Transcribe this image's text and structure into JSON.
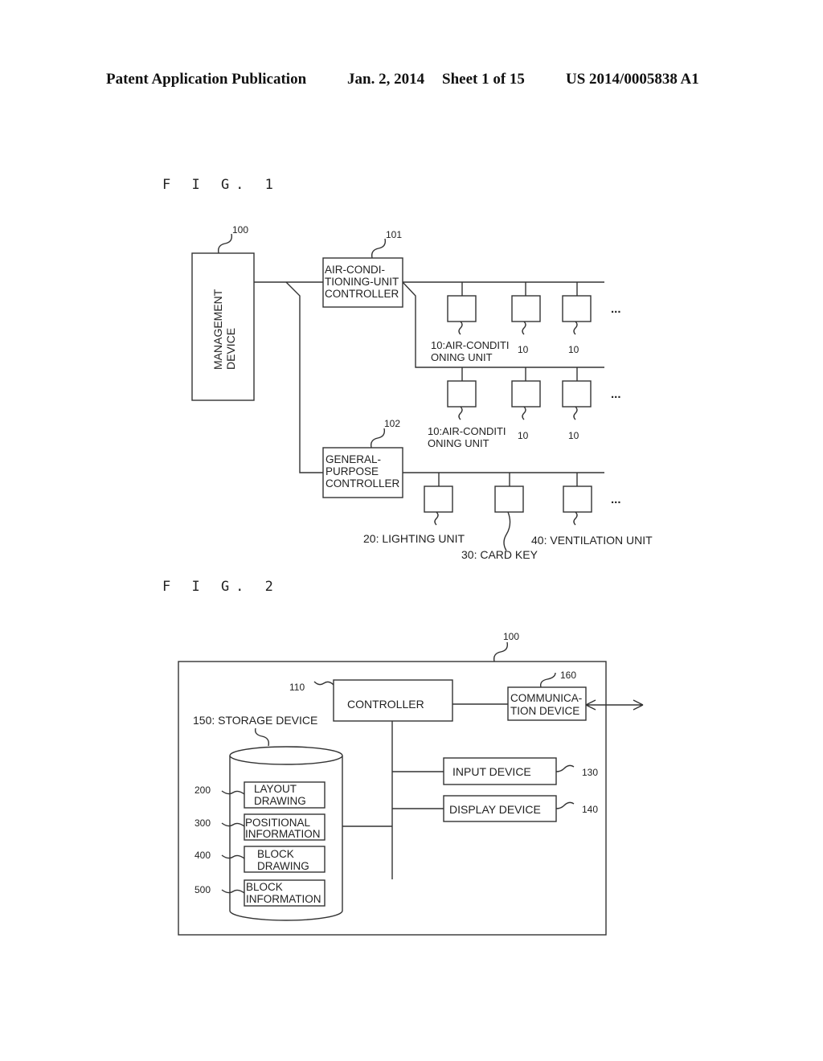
{
  "header": {
    "publication": "Patent Application Publication",
    "date": "Jan. 2, 2014",
    "sheet": "Sheet 1 of 15",
    "number": "US 2014/0005838 A1"
  },
  "fig1": {
    "label": "F I G. 1",
    "management_device": {
      "ref": "100",
      "line1": "MANAGEMENT",
      "line2": "DEVICE"
    },
    "ac_controller": {
      "ref": "101",
      "line1": "AIR-CONDI-",
      "line2": "TIONING-UNIT",
      "line3": "CONTROLLER"
    },
    "gp_controller": {
      "ref": "102",
      "line1": "GENERAL-",
      "line2": "PURPOSE",
      "line3": "CONTROLLER"
    },
    "ac_unit_label": {
      "line1": "10:AIR-CONDITI",
      "line2": "ONING UNIT"
    },
    "ac_unit_ref": "10",
    "ellipsis": "...",
    "lighting_unit": "20: LIGHTING UNIT",
    "card_key": "30: CARD KEY",
    "ventilation_unit": "40: VENTILATION UNIT"
  },
  "fig2": {
    "label": "F I G. 2",
    "device_ref": "100",
    "controller": {
      "ref": "110",
      "label": "CONTROLLER"
    },
    "communication": {
      "ref": "160",
      "line1": "COMMUNICA-",
      "line2": "TION DEVICE"
    },
    "storage_label": "150: STORAGE DEVICE",
    "input_device": {
      "ref": "130",
      "label": "INPUT DEVICE"
    },
    "display_device": {
      "ref": "140",
      "label": "DISPLAY DEVICE"
    },
    "storage_items": [
      {
        "ref": "200",
        "line1": "LAYOUT",
        "line2": "DRAWING"
      },
      {
        "ref": "300",
        "line1": "POSITIONAL",
        "line2": "INFORMATION"
      },
      {
        "ref": "400",
        "line1": "BLOCK",
        "line2": "DRAWING"
      },
      {
        "ref": "500",
        "line1": "BLOCK",
        "line2": "INFORMATION"
      }
    ]
  }
}
